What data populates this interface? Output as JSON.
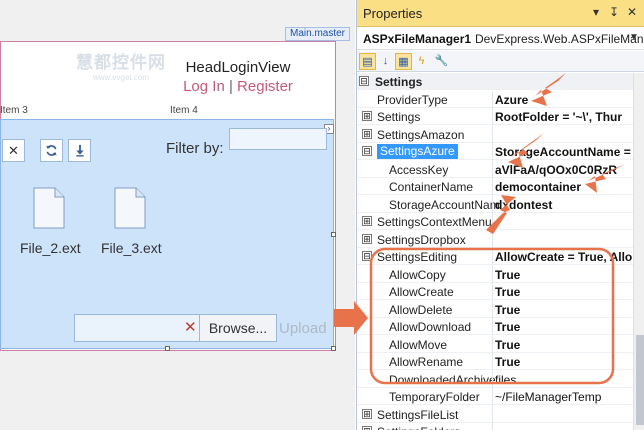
{
  "designer": {
    "master_tag": "Main.master",
    "head_login": {
      "title": "HeadLoginView",
      "login": "Log In",
      "separator": "|",
      "register": "Register"
    },
    "items": [
      "Item 3",
      "Item 4"
    ],
    "toolbar": {
      "delete_icon": "close-icon",
      "refresh_icon": "refresh-icon",
      "download_icon": "download-icon"
    },
    "filter_label": "Filter by:",
    "files": [
      {
        "name": "File_2.ext"
      },
      {
        "name": "File_3.ext"
      }
    ],
    "browse_label": "Browse...",
    "upload_label": "Upload",
    "watermark": {
      "text": "慧都控件网",
      "url": "www.evget.com"
    }
  },
  "properties": {
    "title": "Properties",
    "title_controls": [
      "▾",
      "↧",
      "✕"
    ],
    "object_name": "ASPxFileManager1",
    "object_type": "DevExpress.Web.ASPxFileManag",
    "toolbar_icons": [
      "categorized-icon",
      "alphabetical-icon",
      "properties-icon",
      "events-icon",
      "property-pages-icon"
    ],
    "rows": [
      {
        "type": "cat",
        "expander": "⊟",
        "name": "Settings",
        "value": ""
      },
      {
        "type": "prop",
        "indent": 1,
        "name": "ProviderType",
        "value": "Azure",
        "bold": true
      },
      {
        "type": "prop",
        "indent": 1,
        "expander": "⊞",
        "name": "Settings",
        "value": "RootFolder = '~\\', Thur",
        "bold": true
      },
      {
        "type": "prop",
        "indent": 1,
        "expander": "⊞",
        "name": "SettingsAmazon",
        "value": ""
      },
      {
        "type": "prop",
        "indent": 1,
        "expander": "⊟",
        "name": "SettingsAzure",
        "value": "StorageAccountName = ",
        "bold": true,
        "selected": true
      },
      {
        "type": "prop",
        "indent": 2,
        "name": "AccessKey",
        "value": "aVlFaA/qOOx0C0RzR",
        "bold": true
      },
      {
        "type": "prop",
        "indent": 2,
        "name": "ContainerName",
        "value": "democontainer",
        "bold": true
      },
      {
        "type": "prop",
        "indent": 2,
        "name": "StorageAccountNam",
        "value": "dxdontest",
        "bold": true
      },
      {
        "type": "prop",
        "indent": 1,
        "expander": "⊞",
        "name": "SettingsContextMenu",
        "value": ""
      },
      {
        "type": "prop",
        "indent": 1,
        "expander": "⊞",
        "name": "SettingsDropbox",
        "value": ""
      },
      {
        "type": "prop",
        "indent": 1,
        "expander": "⊟",
        "name": "SettingsEditing",
        "value": "AllowCreate = True, Allo",
        "bold": true
      },
      {
        "type": "prop",
        "indent": 2,
        "name": "AllowCopy",
        "value": "True",
        "bold": true
      },
      {
        "type": "prop",
        "indent": 2,
        "name": "AllowCreate",
        "value": "True",
        "bold": true
      },
      {
        "type": "prop",
        "indent": 2,
        "name": "AllowDelete",
        "value": "True",
        "bold": true
      },
      {
        "type": "prop",
        "indent": 2,
        "name": "AllowDownload",
        "value": "True",
        "bold": true
      },
      {
        "type": "prop",
        "indent": 2,
        "name": "AllowMove",
        "value": "True",
        "bold": true
      },
      {
        "type": "prop",
        "indent": 2,
        "name": "AllowRename",
        "value": "True",
        "bold": true
      },
      {
        "type": "prop",
        "indent": 2,
        "name": "DownloadedArchive",
        "value": "files",
        "bold": false
      },
      {
        "type": "prop",
        "indent": 2,
        "name": "TemporaryFolder",
        "value": "~/FileManagerTemp",
        "bold": false
      },
      {
        "type": "prop",
        "indent": 1,
        "expander": "⊞",
        "name": "SettingsFileList",
        "value": ""
      },
      {
        "type": "prop",
        "indent": 1,
        "expander": "⊞",
        "name": "SettingsFolders",
        "value": ""
      }
    ]
  },
  "colors": {
    "annotation": "#e8734a",
    "title_bar": "#fbdf85",
    "selection": "#3399ff",
    "manager_bg": "#cde3fa"
  }
}
